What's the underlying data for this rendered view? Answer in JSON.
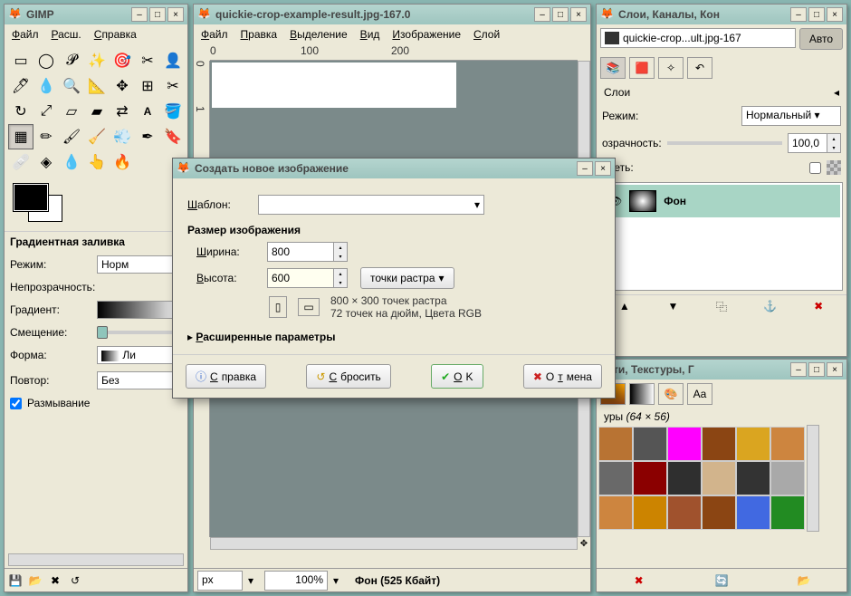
{
  "toolbox": {
    "title": "GIMP",
    "menu": {
      "file": "Файл",
      "ext": "Расш.",
      "help": "Справка"
    },
    "options_title": "Градиентная заливка",
    "mode_label": "Режим:",
    "mode_value": "Норм",
    "opacity_label": "Непрозрачность:",
    "gradient_label": "Градиент:",
    "offset_label": "Смещение:",
    "shape_label": "Форма:",
    "shape_value": "Ли",
    "repeat_label": "Повтор:",
    "repeat_value": "Без",
    "blur_label": "Размывание"
  },
  "imagewin": {
    "title": "quickie-crop-example-result.jpg-167.0",
    "menu": {
      "file": "Файл",
      "edit": "Правка",
      "select": "Выделение",
      "view": "Вид",
      "image": "Изображение",
      "layer": "Слой"
    },
    "unit": "px",
    "zoom": "100%",
    "status": "Фон (525 Кбайт)"
  },
  "layerswin": {
    "title": "Слои, Каналы, Кон",
    "doc_selector": "quickie-crop...ult.jpg-167",
    "auto": "Авто",
    "layers_label": "Слои",
    "mode_label": "Режим:",
    "mode_value": "Нормальный",
    "opacity2_label": "озрачность:",
    "opacity_value": "100,0",
    "lock_label": "ереть:",
    "layer_name": "Фон",
    "brushes_title": "исти, Текстуры, Г",
    "textures_label": "уры",
    "tex_size": "(64 × 56)"
  },
  "dialog": {
    "title": "Создать новое изображение",
    "template_label": "Шаблон:",
    "size_title": "Размер изображения",
    "width_label": "Ширина:",
    "width_value": "800",
    "height_label": "Высота:",
    "height_value": "600",
    "unit_value": "точки растра",
    "info1": "800 × 300 точек растра",
    "info2": "72 точек на дюйм, Цвета RGB",
    "advanced": "Расширенные параметры",
    "help": "Справка",
    "reset": "Сбросить",
    "ok": "OK",
    "cancel": "Отмена"
  },
  "textures": [
    "#b87333",
    "#555",
    "#ff00ff",
    "#8b4513",
    "#daa520",
    "#cd853f",
    "#696969",
    "#8b0000",
    "#2f2f2f",
    "#d2b48c",
    "#333",
    "#a9a9a9",
    "#cd853f",
    "#cc8400",
    "#a0522d",
    "#8b4513",
    "#4169e1",
    "#228b22"
  ]
}
